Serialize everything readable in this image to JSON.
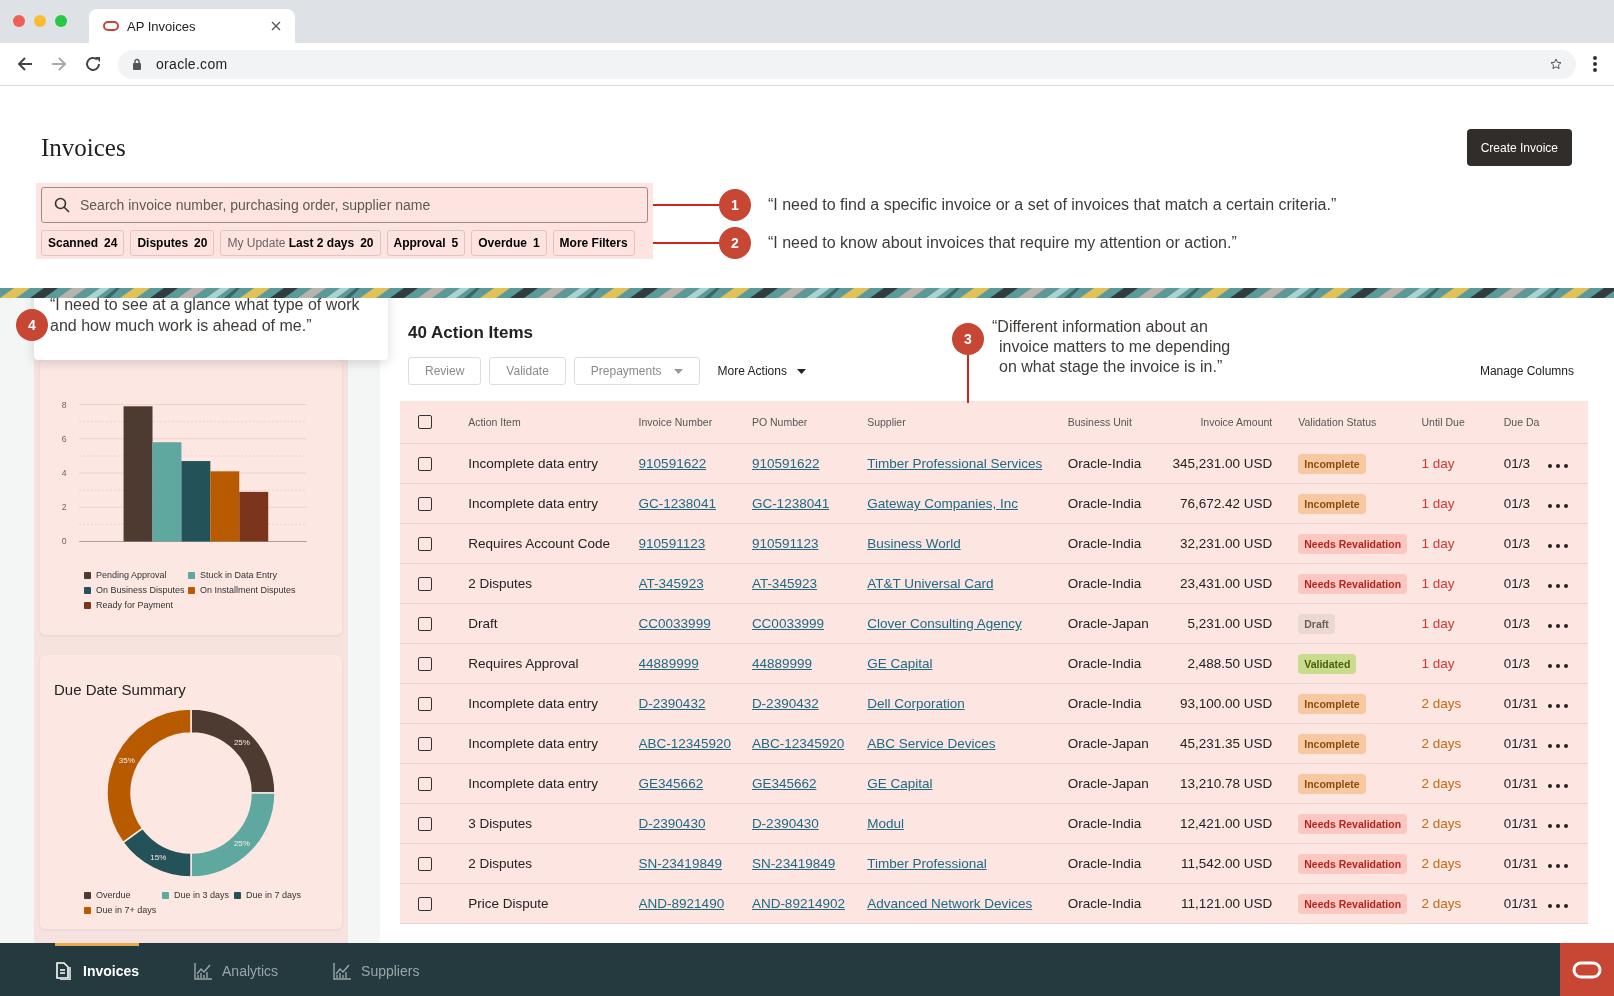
{
  "browser": {
    "tab_title": "AP Invoices",
    "url": "oracle.com"
  },
  "page": {
    "title": "Invoices",
    "create_button": "Create Invoice"
  },
  "search": {
    "placeholder": "Search invoice number, purchasing order, supplier name"
  },
  "filter_chips": [
    {
      "label": "Scanned",
      "count": "24"
    },
    {
      "label": "Disputes",
      "count": "20"
    },
    {
      "prefix": "My Update",
      "label": "Last 2 days",
      "count": "20"
    },
    {
      "label": "Approval",
      "count": "5"
    },
    {
      "label": "Overdue",
      "count": "1"
    },
    {
      "label": "More Filters"
    }
  ],
  "callouts": [
    {
      "number": "1",
      "text": "“I need to find a specific invoice or a set of invoices that match a certain criteria.”"
    },
    {
      "number": "2",
      "text": "“I need to know about invoices that require my attention or action.”"
    },
    {
      "number": "3",
      "text": "“Different information about an invoice matters to me depending on what stage the invoice is in.”"
    },
    {
      "number": "4",
      "text": "“I need to see at a glance what type of work and how much work is ahead of me.”"
    }
  ],
  "bar_card": {
    "chart_data": {
      "type": "bar",
      "series": [
        {
          "name": "Pending Approval",
          "color": "#4d3b32",
          "values": [
            7.9
          ]
        },
        {
          "name": "Stuck in Data Entry",
          "color": "#5fa8a0",
          "values": [
            5.8
          ]
        },
        {
          "name": "On Business Disputes",
          "color": "#235359",
          "values": [
            4.7
          ]
        },
        {
          "name": "On Installment Disputes",
          "color": "#b85b00",
          "values": [
            4.1
          ]
        },
        {
          "name": "Ready for Payment",
          "color": "#7a351c",
          "values": [
            2.9
          ]
        }
      ],
      "ylim": [
        0,
        8
      ],
      "yticks": [
        0,
        2,
        4,
        6,
        8
      ],
      "grid": true
    }
  },
  "donut_card": {
    "title": "Due Date Summary",
    "chart_data": {
      "type": "donut",
      "categories": [
        "Overdue",
        "Due in 3 days",
        "Due in 7 days",
        "Due in 7+ days"
      ],
      "values": [
        25,
        25,
        15,
        35
      ],
      "value_labels": [
        "25%",
        "25%",
        "15%",
        "35%"
      ]
    },
    "legend": [
      {
        "color": "#4d3b32"
      },
      {
        "color": "#5fa8a0"
      },
      {
        "color": "#235359"
      },
      {
        "color": "#b85b00"
      }
    ]
  },
  "action_items": {
    "title": "40 Action Items",
    "toolbar": [
      {
        "label": "Review",
        "kind": "button",
        "disabled": true
      },
      {
        "label": "Validate",
        "kind": "button",
        "disabled": true
      },
      {
        "label": "Prepayments",
        "kind": "dropdown",
        "disabled": true
      },
      {
        "label": "More Actions",
        "kind": "menu",
        "disabled": false
      }
    ],
    "manage_columns": "Manage Columns",
    "columns": [
      "Action Item",
      "Invoice Number",
      "PO Number",
      "Supplier",
      "Business Unit",
      "Invoice Amount",
      "Validation Status",
      "Until Due",
      "Due Da"
    ],
    "header_checked": false,
    "rows": [
      {
        "checked": false,
        "action": "Incomplete data entry",
        "invoice": "910591622",
        "po": "910591622",
        "supplier": "Timber Professional Services",
        "unit": "Oracle-India",
        "amount": "345,231.00 USD",
        "status": "Incomplete",
        "kind": "incomplete",
        "until_due": "1 day",
        "urgent": true,
        "due_date": "01/3"
      },
      {
        "checked": false,
        "action": "Incomplete data entry",
        "invoice": "GC-1238041",
        "po": "GC-1238041",
        "supplier": "Gateway Companies, Inc",
        "unit": "Oracle-India",
        "amount": "76,672.42 USD",
        "status": "Incomplete",
        "kind": "incomplete",
        "until_due": "1 day",
        "urgent": true,
        "due_date": "01/3"
      },
      {
        "checked": false,
        "action": "Requires Account Code",
        "invoice": "910591123",
        "po": "910591123",
        "supplier": "Business World",
        "unit": "Oracle-India",
        "amount": "32,231.00 USD",
        "status": "Needs Revalidation",
        "kind": "revalidate",
        "until_due": "1 day",
        "urgent": true,
        "due_date": "01/3"
      },
      {
        "checked": false,
        "action": "2 Disputes",
        "invoice": "AT-345923",
        "po": "AT-345923",
        "supplier": "AT&T Universal Card",
        "unit": "Oracle-India",
        "amount": "23,431.00 USD",
        "status": "Needs Revalidation",
        "kind": "revalidate",
        "until_due": "1 day",
        "urgent": true,
        "due_date": "01/3"
      },
      {
        "checked": false,
        "action": "Draft",
        "invoice": "CC0033999",
        "po": "CC0033999",
        "supplier": "Clover Consulting Agency",
        "unit": "Oracle-Japan",
        "amount": "5,231.00 USD",
        "status": "Draft",
        "kind": "draft",
        "until_due": "1 day",
        "urgent": true,
        "due_date": "01/3"
      },
      {
        "checked": false,
        "action": "Requires Approval",
        "invoice": "44889999",
        "po": "44889999",
        "supplier": "GE Capital",
        "unit": "Oracle-India",
        "amount": "2,488.50 USD",
        "status": "Validated",
        "kind": "validated",
        "until_due": "1 day",
        "urgent": true,
        "due_date": "01/3"
      },
      {
        "checked": false,
        "action": "Incomplete data entry",
        "invoice": "D-2390432",
        "po": "D-2390432",
        "supplier": "Dell Corporation",
        "unit": "Oracle-India",
        "amount": "93,100.00 USD",
        "status": "Incomplete",
        "kind": "incomplete",
        "until_due": "2 days",
        "urgent": false,
        "due_date": "01/31"
      },
      {
        "checked": false,
        "action": "Incomplete data entry",
        "invoice": "ABC-12345920",
        "po": "ABC-12345920",
        "supplier": "ABC Service Devices",
        "unit": "Oracle-Japan",
        "amount": "45,231.35 USD",
        "status": "Incomplete",
        "kind": "incomplete",
        "until_due": "2 days",
        "urgent": false,
        "due_date": "01/31"
      },
      {
        "checked": false,
        "action": "Incomplete data entry",
        "invoice": "GE345662",
        "po": "GE345662",
        "supplier": "GE Capital",
        "unit": "Oracle-Japan",
        "amount": "13,210.78 USD",
        "status": "Incomplete",
        "kind": "incomplete",
        "until_due": "2 days",
        "urgent": false,
        "due_date": "01/31"
      },
      {
        "checked": false,
        "action": "3 Disputes",
        "invoice": "D-2390430",
        "po": "D-2390430",
        "supplier": "Modul",
        "unit": "Oracle-India",
        "amount": "12,421.00 USD",
        "status": "Needs Revalidation",
        "kind": "revalidate",
        "until_due": "2 days",
        "urgent": false,
        "due_date": "01/31"
      },
      {
        "checked": false,
        "action": "2 Disputes",
        "invoice": "SN-23419849",
        "po": "SN-23419849",
        "supplier": "Timber Professional",
        "unit": "Oracle-India",
        "amount": "11,542.00 USD",
        "status": "Needs Revalidation",
        "kind": "revalidate",
        "until_due": "2 days",
        "urgent": false,
        "due_date": "01/31"
      },
      {
        "checked": false,
        "action": "Price Dispute",
        "invoice": "AND-8921490",
        "po": "AND-89214902",
        "supplier": "Advanced Network Devices",
        "unit": "Oracle-India",
        "amount": "11,121.00 USD",
        "status": "Needs Revalidation",
        "kind": "revalidate",
        "until_due": "2 days",
        "urgent": false,
        "due_date": "01/31"
      }
    ]
  },
  "bottom_nav": [
    {
      "label": "Invoices",
      "selected": true
    },
    {
      "label": "Analytics",
      "selected": false
    },
    {
      "label": "Suppliers",
      "selected": false
    }
  ]
}
